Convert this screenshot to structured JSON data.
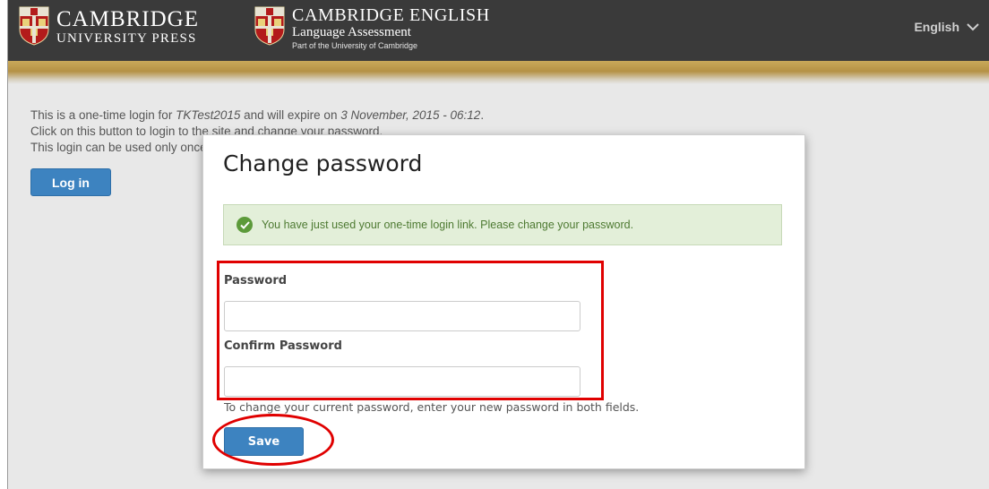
{
  "header": {
    "cup_line1": "CAMBRIDGE",
    "cup_line2": "UNIVERSITY PRESS",
    "ce_line1": "CAMBRIDGE ENGLISH",
    "ce_line2": "Language Assessment",
    "ce_line3": "Part of the University of Cambridge",
    "language": "English",
    "language_icon": "chevron-down-icon"
  },
  "page": {
    "line1_prefix": "This is a one-time login for ",
    "line1_user": "TKTest2015",
    "line1_mid": " and will expire on ",
    "line1_date": "3 November, 2015 - 06:12",
    "line1_suffix": ".",
    "line2": "Click on this button to login to the site and change your password.",
    "line3": "This login can be used only once.",
    "login_label": "Log in"
  },
  "modal": {
    "title": "Change password",
    "alert_text": "You have just used your one-time login link. Please change your password.",
    "password_label": "Password",
    "password_value": "",
    "confirm_label": "Confirm Password",
    "confirm_value": "",
    "help_text": "To change your current password, enter your new password in both fields.",
    "save_label": "Save"
  },
  "colors": {
    "header_bg": "#3a3a3a",
    "gold": "#c9a95a",
    "button_blue": "#3d83c0",
    "alert_green_bg": "#e3efd9",
    "annotation_red": "#e00000"
  }
}
